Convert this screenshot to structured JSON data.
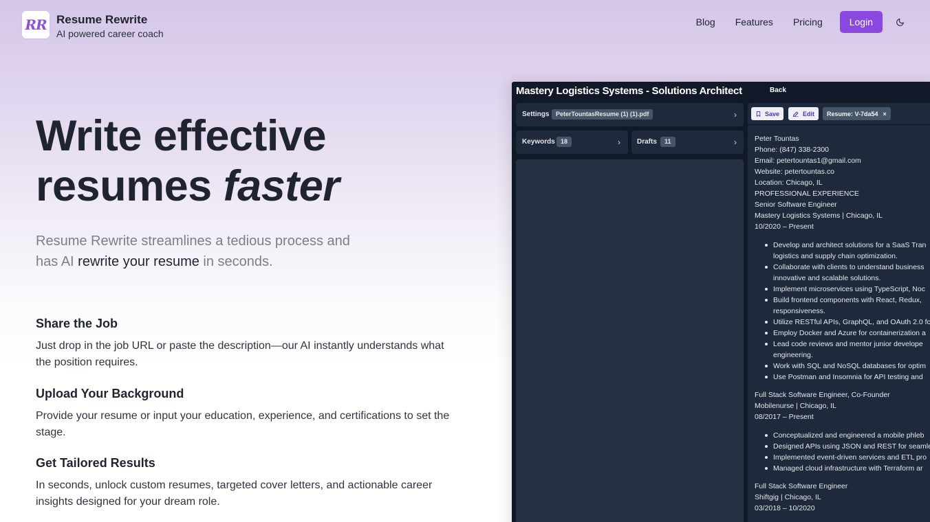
{
  "header": {
    "logo_text": "RR",
    "brand_name": "Resume Rewrite",
    "brand_tagline": "AI powered career coach",
    "nav": [
      "Blog",
      "Features",
      "Pricing"
    ],
    "login_label": "Login",
    "theme_icon": "moon-icon"
  },
  "hero": {
    "title_line1": "Write effective",
    "title_line2_start": "resumes ",
    "title_line2_em": "faster",
    "subtitle_start": "Resume Rewrite streamlines a tedious process and has AI ",
    "subtitle_highlight": "rewrite your resume",
    "subtitle_end": " in seconds."
  },
  "features": [
    {
      "title": "Share the Job",
      "body": "Just drop in the job URL or paste the description—our AI instantly understands what the position requires."
    },
    {
      "title": "Upload Your Background",
      "body": "Provide your resume or input your education, experience, and certifications to set the stage."
    },
    {
      "title": "Get Tailored Results",
      "body": "In seconds, unlock custom resumes, targeted cover letters, and actionable career insights designed for your dream role."
    }
  ],
  "preview": {
    "title": "Mastery Logistics Systems - Solutions Architect",
    "back_label": "Back",
    "settings_label": "Settings",
    "settings_file": "PeterTountasResume (1) (1).pdf",
    "keywords_label": "Keywords",
    "keywords_count": "18",
    "drafts_label": "Drafts",
    "drafts_count": "11",
    "save_label": "Save",
    "edit_label": "Edit",
    "resume_chip": "Resume: V-7da54",
    "resume_chip_close": "×",
    "resume_header": [
      "Peter Tountas",
      "Phone: (847) 338-2300",
      "Email: petertountas1@gmail.com",
      "Website: petertountas.co",
      "Location: Chicago, IL",
      "PROFESSIONAL EXPERIENCE",
      "Senior Software Engineer",
      "Mastery Logistics Systems | Chicago, IL",
      "10/2020 – Present"
    ],
    "job1_bullets": [
      "Develop and architect solutions for a SaaS Tran",
      "logistics and supply chain optimization.",
      "Collaborate with clients to understand business",
      "innovative and scalable solutions.",
      "Implement microservices using TypeScript, Noc",
      "Build frontend components with React, Redux,",
      "responsiveness.",
      "Utilize RESTful APIs, GraphQL, and OAuth 2.0 fc",
      "Employ Docker and Azure for containerization a",
      "Lead code reviews and mentor junior develope",
      "engineering.",
      "Work with SQL and NoSQL databases for optim",
      "Use Postman and Insomnia for API testing and"
    ],
    "job2_header": [
      "Full Stack Software Engineer, Co-Founder",
      "Mobilenurse | Chicago, IL",
      "08/2017 – Present"
    ],
    "job2_bullets": [
      "Conceptualized and engineered a mobile phleb",
      "Designed APIs using JSON and REST for seamle",
      "Implemented event-driven services and ETL pro",
      "Managed cloud infrastructure with Terraform ar"
    ],
    "job3_header": [
      "Full Stack Software Engineer",
      "Shiftgig | Chicago, IL",
      "03/2018 – 10/2020"
    ]
  }
}
